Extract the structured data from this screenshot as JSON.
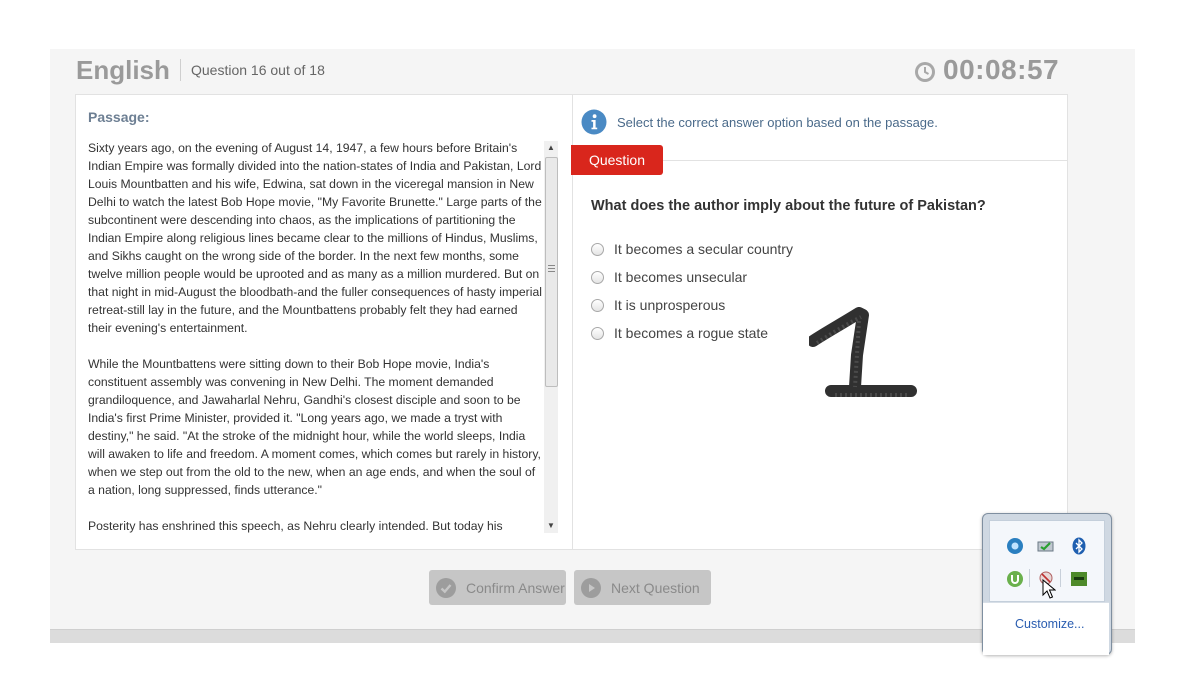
{
  "header": {
    "subject": "English",
    "question_counter": "Question 16 out of 18",
    "timer": "00:08:57",
    "timer_icon": "clock-icon"
  },
  "passage": {
    "label": "Passage:",
    "paragraphs": [
      "Sixty years ago, on the evening of August 14, 1947, a few hours before Britain's Indian Empire was formally divided into the nation-states of India and Pakistan, Lord Louis Mountbatten and his wife, Edwina, sat down in the viceregal mansion in New Delhi to watch the latest Bob Hope movie, \"My Favorite Brunette.\" Large parts of the subcontinent were descending into chaos, as the implications of partitioning the Indian Empire along religious lines became clear to the millions of Hindus, Muslims, and Sikhs caught on the wrong side of the border. In the next few months, some twelve million people would be uprooted and as many as a million murdered. But on that night in mid-August the bloodbath-and the fuller consequences of hasty imperial retreat-still lay in the future, and the Mountbattens probably felt they had earned their evening's entertainment.",
      "While the Mountbattens were sitting down to their Bob Hope movie, India's constituent assembly was convening in New Delhi. The moment demanded grandiloquence, and Jawaharlal Nehru, Gandhi's closest disciple and soon to be India's first Prime Minister, provided it. \"Long years ago, we made a tryst with destiny,\" he said. \"At the stroke of the midnight hour, while the world sleeps, India will awaken to life and freedom. A moment comes, which comes but rarely in history, when we step out from the old to the new, when an age ends, and when the soul of a nation, long suppressed, finds utterance.\"",
      "Posterity has enshrined this speech, as Nehru clearly intended. But today his"
    ]
  },
  "question_panel": {
    "instruction": "Select the correct answer option based on the passage.",
    "tab_label": "Question",
    "question": "What does the author imply about the future of Pakistan?",
    "options": [
      "It becomes a secular country",
      "It becomes unsecular",
      "It is unprosperous",
      "It becomes a rogue state"
    ],
    "annotation": "1"
  },
  "buttons": {
    "confirm": "Confirm Answer",
    "next": "Next Question"
  },
  "tray": {
    "customize": "Customize...",
    "icons": [
      "network-icon",
      "battery-icon",
      "bluetooth-icon",
      "torrent-icon",
      "disabled-app-icon",
      "app-icon"
    ]
  },
  "colors": {
    "accent_red": "#d9261c",
    "info_blue": "#4a8ac4",
    "header_gray": "#9a9a9a"
  }
}
